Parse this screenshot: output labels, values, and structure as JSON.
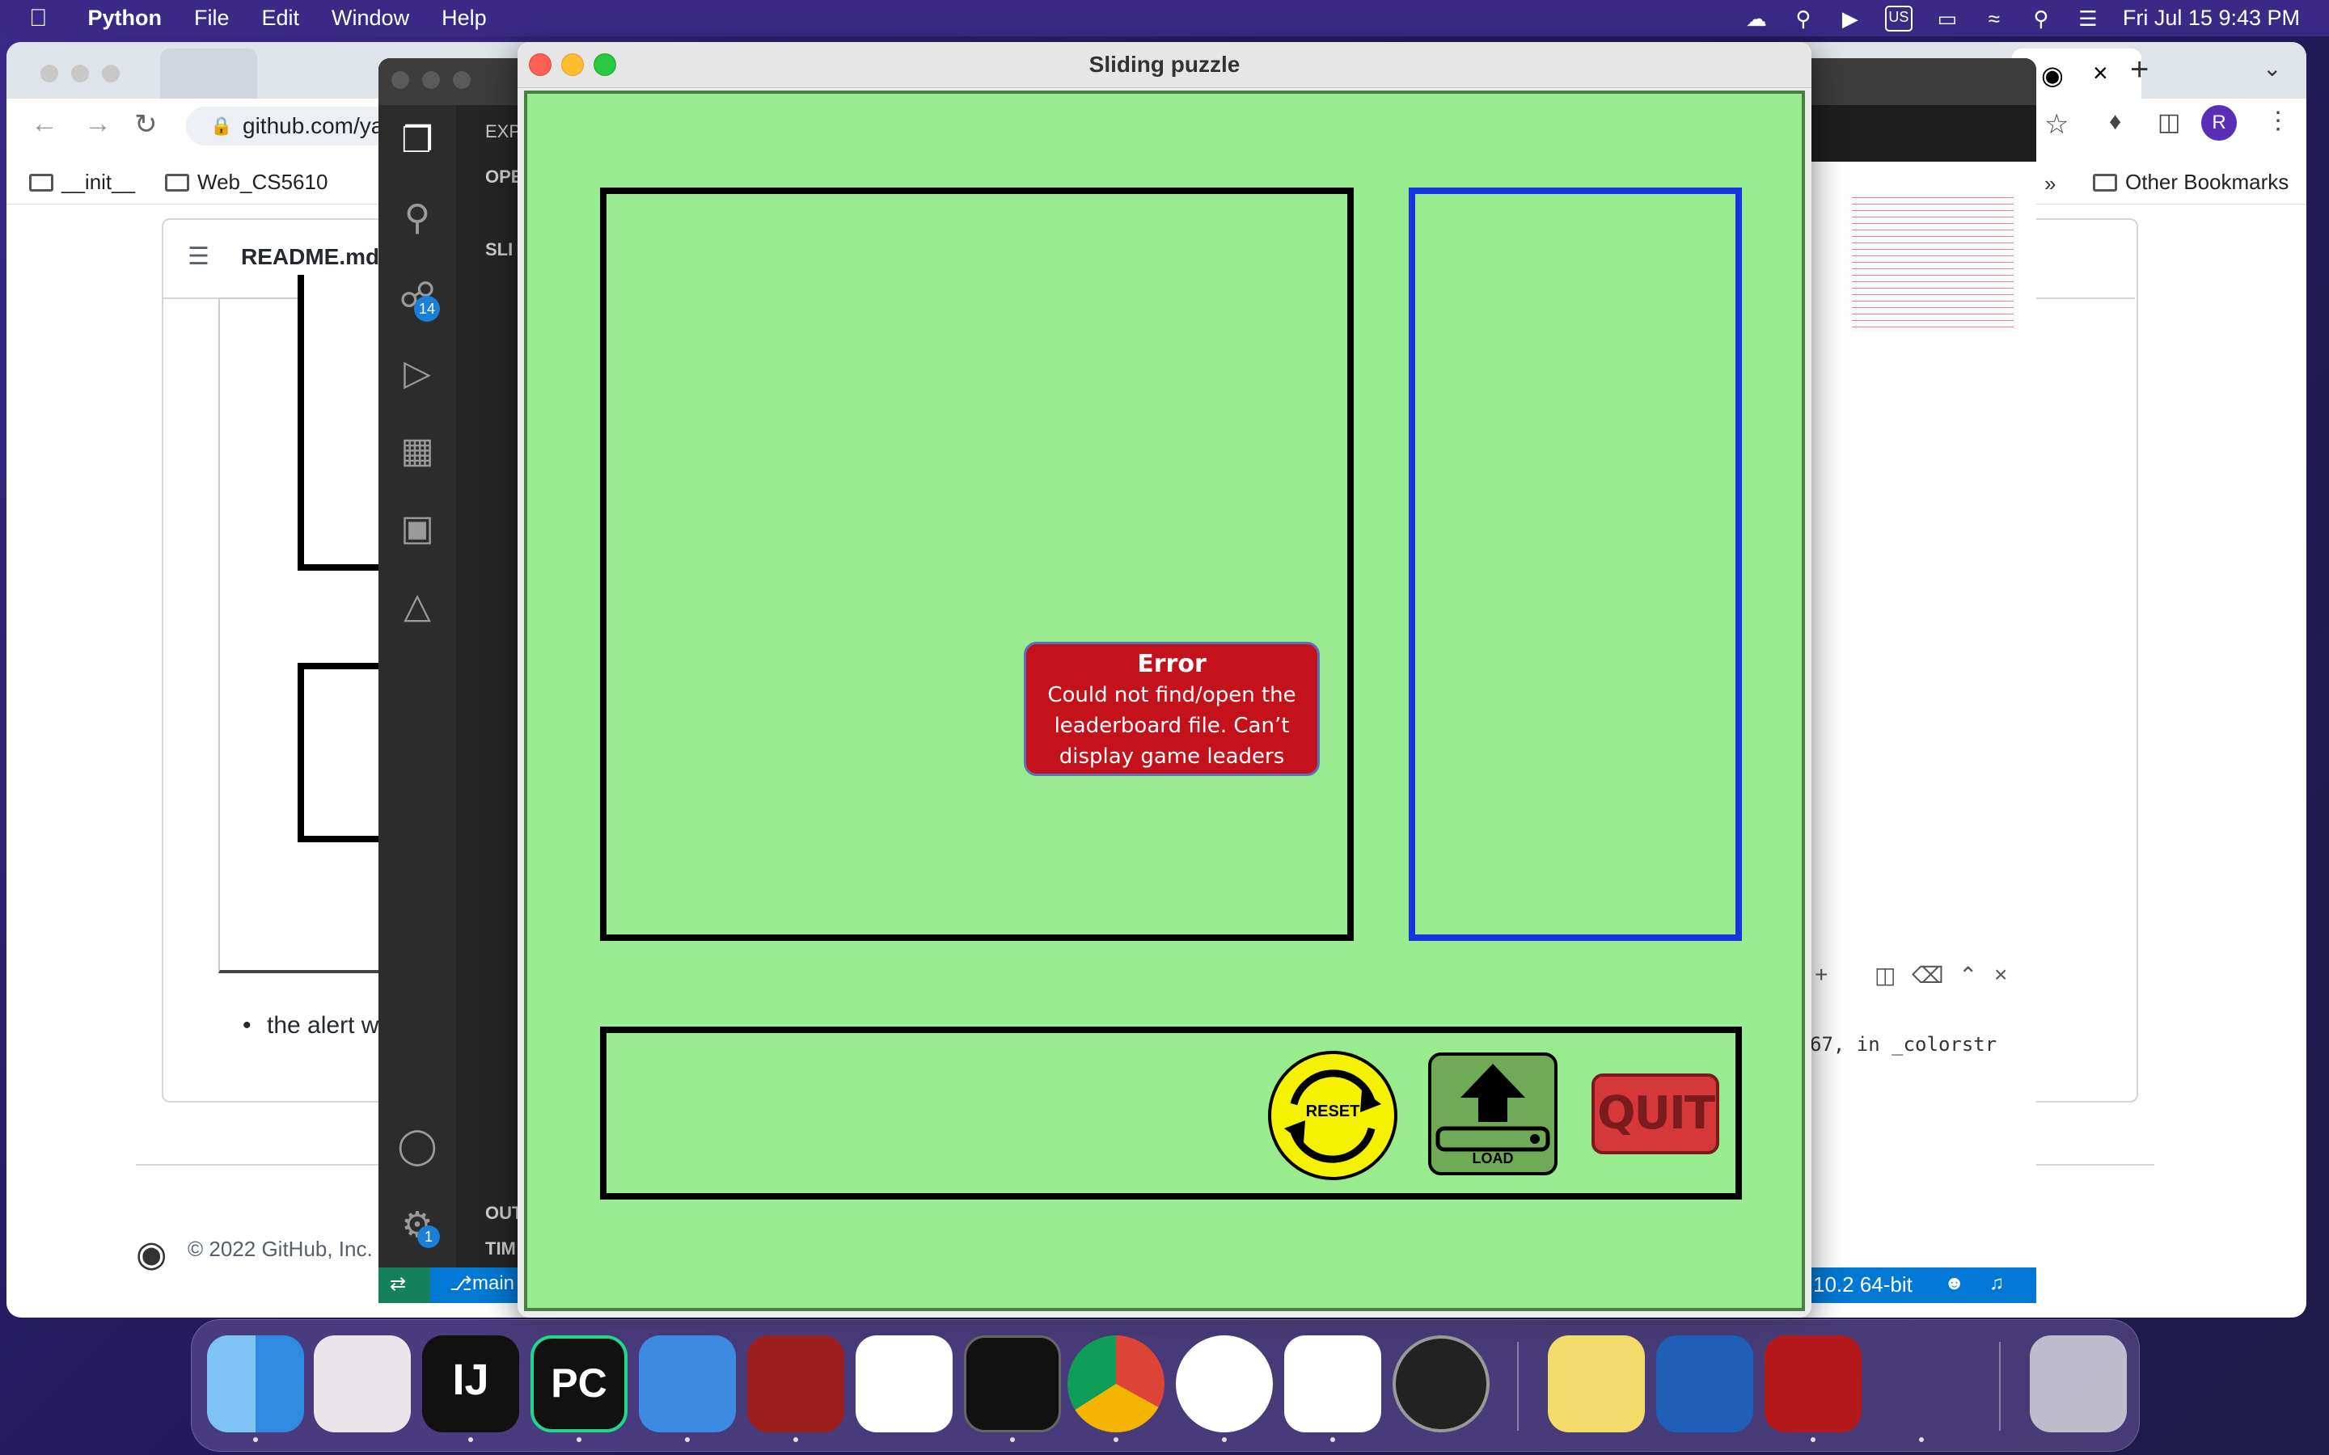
{
  "menubar": {
    "apple": "",
    "app_name": "Python",
    "items": [
      "File",
      "Edit",
      "Window",
      "Help"
    ],
    "clock": "Fri Jul 15  9:43 PM"
  },
  "chrome": {
    "url": "github.com/ya",
    "bookmarks": [
      "__init__",
      "Web_CS5610"
    ],
    "other_bookmarks": "Other Bookmarks",
    "profile_initial": "R"
  },
  "readme": {
    "title": "README.md",
    "bullet": "the alert w",
    "footer": "© 2022 GitHub, Inc."
  },
  "vscode": {
    "scm_badge": "14",
    "settings_badge": "1",
    "sidebar_labels": [
      "EXP",
      "OPE",
      "SLI",
      "OUT",
      "TIM"
    ],
    "branch": "main",
    "terminal_text": "67, in _colorstr",
    "status_right": "10.2 64-bit"
  },
  "puzzle": {
    "window_title": "Sliding puzzle",
    "error_title": "Error",
    "error_message": "Could not find/open the leaderboard file. Can’t display game leaders",
    "reset_label": "RESET",
    "load_label": "LOAD",
    "quit_label": "QUIT",
    "colors": {
      "background": "#98eb8e",
      "board_border": "#000000",
      "leaderboard_border": "#1634e0",
      "error_bg": "#c4121c"
    }
  },
  "dock": {
    "apps": [
      "finder-icon",
      "launchpad-icon",
      "intellij-icon",
      "pycharm-icon",
      "dictionary-icon",
      "dictionary-app-icon",
      "reminders-icon",
      "terminal-icon",
      "chrome-icon",
      "evernote-icon",
      "vscode-icon",
      "clock-icon",
      "stickies-icon",
      "word-icon",
      "acrobat-icon",
      "python-launcher-icon",
      "trash-icon"
    ],
    "pycharm_text": "PC",
    "intellij_text": "IJ"
  }
}
